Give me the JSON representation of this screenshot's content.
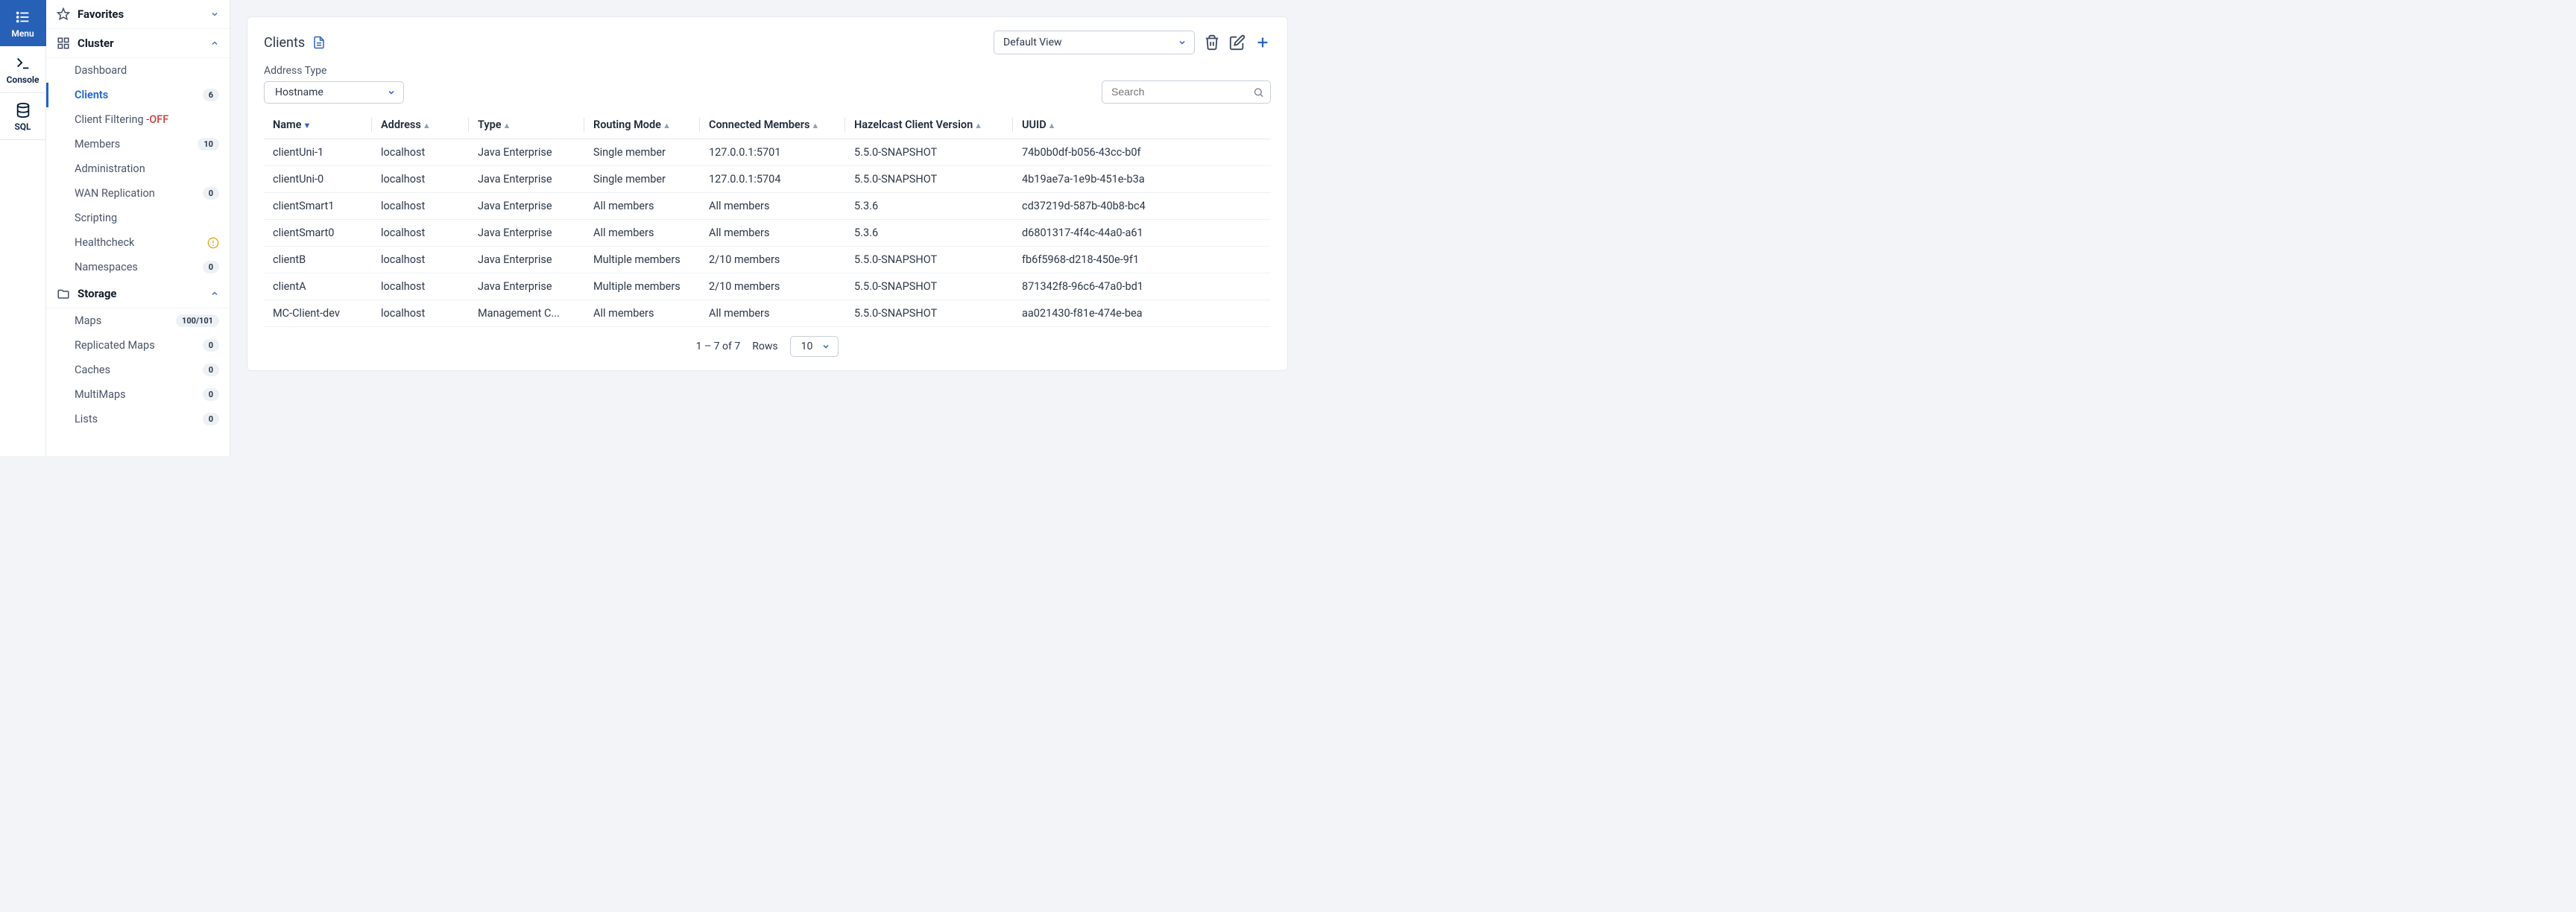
{
  "rail": {
    "menu": "Menu",
    "console": "Console",
    "sql": "SQL"
  },
  "sidebar": {
    "sections": {
      "favorites": {
        "title": "Favorites"
      },
      "cluster": {
        "title": "Cluster",
        "items": [
          {
            "label": "Dashboard"
          },
          {
            "label": "Clients",
            "badge": "6",
            "active": true
          },
          {
            "label": "Client Filtering - ",
            "suffix": "OFF"
          },
          {
            "label": "Members",
            "badge": "10"
          },
          {
            "label": "Administration"
          },
          {
            "label": "WAN Replication",
            "badge": "0"
          },
          {
            "label": "Scripting"
          },
          {
            "label": "Healthcheck",
            "warn": true
          },
          {
            "label": "Namespaces",
            "badge": "0"
          }
        ]
      },
      "storage": {
        "title": "Storage",
        "items": [
          {
            "label": "Maps",
            "badge": "100/101"
          },
          {
            "label": "Replicated Maps",
            "badge": "0"
          },
          {
            "label": "Caches",
            "badge": "0"
          },
          {
            "label": "MultiMaps",
            "badge": "0"
          },
          {
            "label": "Lists",
            "badge": "0"
          }
        ]
      }
    }
  },
  "page": {
    "title": "Clients",
    "view_selected": "Default View",
    "filter": {
      "label": "Address Type",
      "selected": "Hostname"
    },
    "search_placeholder": "Search",
    "columns": [
      "Name",
      "Address",
      "Type",
      "Routing Mode",
      "Connected Members",
      "Hazelcast Client Version",
      "UUID"
    ],
    "rows": [
      {
        "name": "clientUni-1",
        "address": "localhost",
        "type": "Java Enterprise",
        "routing": "Single member",
        "connected": "127.0.0.1:5701",
        "version": "5.5.0-SNAPSHOT",
        "uuid": "74b0b0df-b056-43cc-b0f"
      },
      {
        "name": "clientUni-0",
        "address": "localhost",
        "type": "Java Enterprise",
        "routing": "Single member",
        "connected": "127.0.0.1:5704",
        "version": "5.5.0-SNAPSHOT",
        "uuid": "4b19ae7a-1e9b-451e-b3a"
      },
      {
        "name": "clientSmart1",
        "address": "localhost",
        "type": "Java Enterprise",
        "routing": "All members",
        "connected": "All members",
        "version": "5.3.6",
        "uuid": "cd37219d-587b-40b8-bc4"
      },
      {
        "name": "clientSmart0",
        "address": "localhost",
        "type": "Java Enterprise",
        "routing": "All members",
        "connected": "All members",
        "version": "5.3.6",
        "uuid": "d6801317-4f4c-44a0-a61"
      },
      {
        "name": "clientB",
        "address": "localhost",
        "type": "Java Enterprise",
        "routing": "Multiple members",
        "connected": "2/10 members",
        "version": "5.5.0-SNAPSHOT",
        "uuid": "fb6f5968-d218-450e-9f1"
      },
      {
        "name": "clientA",
        "address": "localhost",
        "type": "Java Enterprise",
        "routing": "Multiple members",
        "connected": "2/10 members",
        "version": "5.5.0-SNAPSHOT",
        "uuid": "871342f8-96c6-47a0-bd1"
      },
      {
        "name": "MC-Client-dev",
        "address": "localhost",
        "type": "Management C...",
        "routing": "All members",
        "connected": "All members",
        "version": "5.5.0-SNAPSHOT",
        "uuid": "aa021430-f81e-474e-bea"
      }
    ],
    "pager": {
      "range": "1 – 7 of 7",
      "rows_label": "Rows",
      "rows_selected": "10"
    }
  }
}
